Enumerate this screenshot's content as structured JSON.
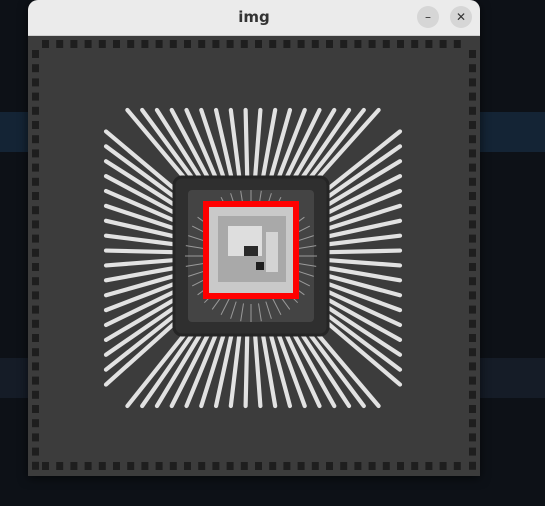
{
  "window": {
    "title": "img"
  },
  "controls": {
    "minimize_glyph": "–",
    "close_glyph": "✕"
  },
  "image": {
    "subject": "chip-package-leadframe",
    "highlight_color": "#ff0000",
    "icons": {
      "minimize": "minimize-icon",
      "close": "close-icon"
    }
  }
}
